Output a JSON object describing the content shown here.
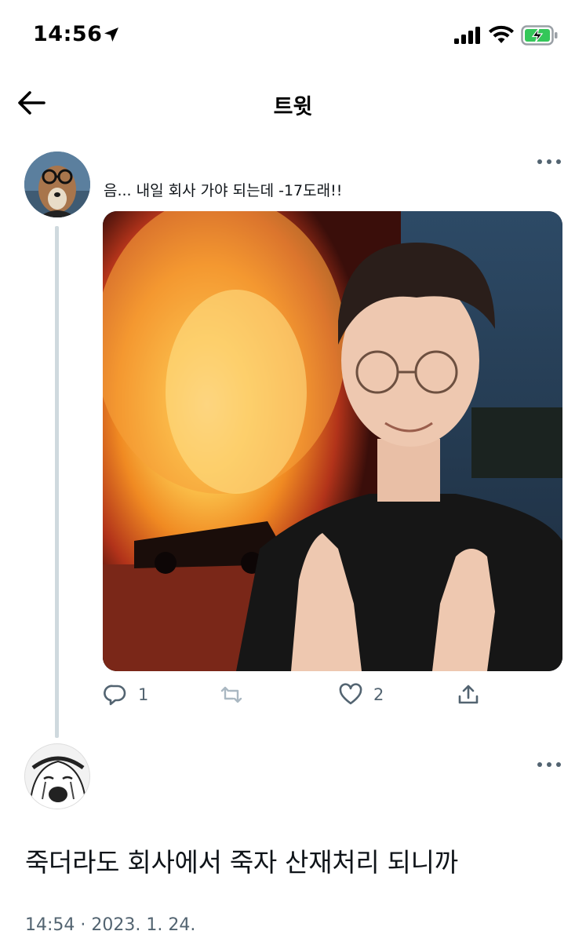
{
  "status_bar": {
    "time": "14:56"
  },
  "nav": {
    "title": "트윗"
  },
  "tweet1": {
    "text": "음... 내일 회사 가야 되는데 -17도래!!",
    "reply_count": "1",
    "retweet_count": "",
    "like_count": "2"
  },
  "tweet2": {
    "text": "죽더라도 회사에서 죽자 산재처리 되니까",
    "timestamp": "14:54 · 2023. 1. 24."
  },
  "colors": {
    "secondary_text": "#536471",
    "thread_line": "#cfd9de",
    "icon": "#536471"
  }
}
